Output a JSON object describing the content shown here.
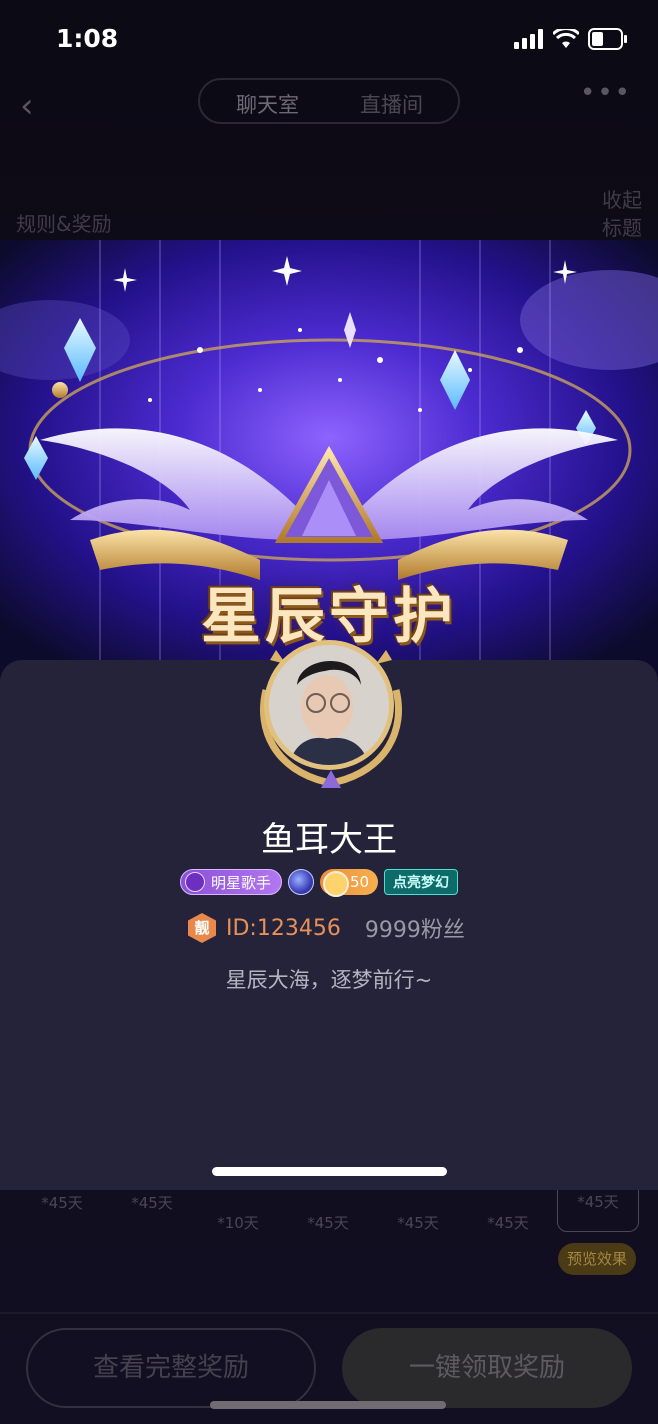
{
  "status": {
    "time": "1:08"
  },
  "topbar": {
    "back_icon": "chevron-left-icon",
    "tabs": [
      "聊天室",
      "直播间"
    ],
    "more_label": "•••"
  },
  "page": {
    "rules_label": "规则&奖励",
    "collapse_label_1": "收起",
    "collapse_label_2": "标题",
    "grid": [
      {
        "label": "*45天"
      },
      {
        "label": "*45天"
      },
      {
        "label": "*10天"
      },
      {
        "label": "*45天"
      },
      {
        "label": "*45天"
      },
      {
        "label": "*45天"
      },
      {
        "label": "*45天"
      }
    ],
    "preview_label": "预览效果",
    "view_full_label": "查看完整奖励",
    "claim_label": "一键领取奖励"
  },
  "banner": {
    "title": "星辰守护"
  },
  "profile": {
    "name": "鱼耳大王",
    "badges": {
      "star_singer": "明星歌手",
      "level": "50",
      "light_up": "点亮梦幻"
    },
    "liang_icon_text": "靓",
    "id": "ID:123456",
    "fans": "9999粉丝",
    "bio": "星辰大海，逐梦前行~"
  },
  "colors": {
    "sheet_bg": "#25233a",
    "id_orange": "#e7905a",
    "gold": "#e2c17f",
    "purple_accent": "#8a50d6"
  }
}
